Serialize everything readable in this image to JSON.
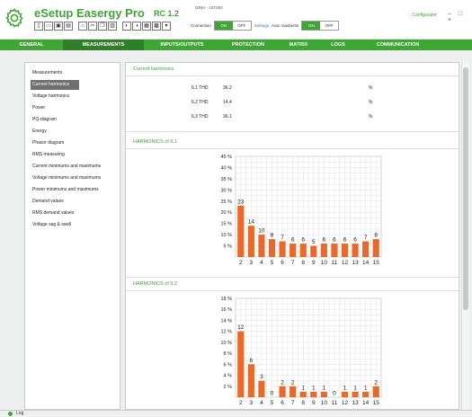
{
  "app": {
    "title": "eSetup Easergy Pro",
    "version": "RC 1.2",
    "device_id": "00NH - 16T600",
    "configurator_label": "Configurator",
    "window_controls": "– □ ×"
  },
  "toolbar": {
    "connection_label": "Connection",
    "on_label": "ON",
    "off_label": "OFF",
    "settings_label": "Settings",
    "autoread_label": "Auto read/write"
  },
  "nav": {
    "tabs": [
      {
        "label": "GENERAL"
      },
      {
        "label": "MEASUREMENTS"
      },
      {
        "label": "INPUTS/OUTPUTS"
      },
      {
        "label": "PROTECTION"
      },
      {
        "label": "MATRIX"
      },
      {
        "label": "LOGS"
      },
      {
        "label": "COMMUNICATION"
      }
    ],
    "active": "MEASUREMENTS"
  },
  "sidebar": {
    "items": [
      {
        "label": "Measurements"
      },
      {
        "label": "Current harmonics"
      },
      {
        "label": "Voltage harmonics"
      },
      {
        "label": "Power"
      },
      {
        "label": "PQ-diagram"
      },
      {
        "label": "Energy"
      },
      {
        "label": "Phasor diagram"
      },
      {
        "label": "RMS measuring"
      },
      {
        "label": "Current minimums and maximums"
      },
      {
        "label": "Voltage minimums and maximums"
      },
      {
        "label": "Power minimums and maximums"
      },
      {
        "label": "Demand values"
      },
      {
        "label": "RMS demand values"
      },
      {
        "label": "Voltage sag & swell"
      }
    ],
    "active": "Current harmonics"
  },
  "current_harmonics": {
    "title": "Current harmonics",
    "rows": [
      {
        "label": "IL1 THD",
        "value": "36.2",
        "unit": "%"
      },
      {
        "label": "IL2 THD",
        "value": "14.4",
        "unit": "%"
      },
      {
        "label": "IL3 THD",
        "value": "36.1",
        "unit": "%"
      }
    ]
  },
  "colors": {
    "brand_green": "#3fa535",
    "nav_active": "#2e7f28",
    "bar_orange": "#e8692a"
  },
  "chart_data": [
    {
      "type": "bar",
      "title": "HARMONICS of IL1",
      "categories": [
        "2",
        "3",
        "4",
        "5",
        "6",
        "7",
        "8",
        "9",
        "10",
        "11",
        "12",
        "13",
        "14",
        "15"
      ],
      "values": [
        23,
        14,
        10,
        8,
        7,
        6,
        6,
        5,
        6,
        6,
        6,
        6,
        7,
        8
      ],
      "data_labels": [
        "23",
        "14",
        "10",
        "8",
        "7",
        "6",
        "6",
        "5",
        "6",
        "6",
        "6",
        "6",
        "7",
        "8"
      ],
      "y_ticks": [
        "5 %",
        "10 %",
        "15 %",
        "20 %",
        "25 %",
        "30 %",
        "35 %",
        "40 %",
        "45 %"
      ],
      "ylim": [
        0,
        45
      ],
      "grid": true
    },
    {
      "type": "bar",
      "title": "HARMONICS of IL2",
      "categories": [
        "2",
        "3",
        "4",
        "5",
        "6",
        "7",
        "8",
        "9",
        "10",
        "11",
        "12",
        "13",
        "14",
        "15"
      ],
      "values": [
        12,
        6,
        3,
        0,
        2,
        2,
        1,
        1,
        1,
        0,
        1,
        1,
        1,
        2
      ],
      "data_labels": [
        "12",
        "6",
        "3",
        "0",
        "2",
        "2",
        "1",
        "1",
        "1",
        "0",
        "1",
        "1",
        "1",
        "2"
      ],
      "y_ticks": [
        "2 %",
        "4 %",
        "6 %",
        "8 %",
        "10 %",
        "12 %",
        "14 %",
        "16 %",
        "18 %"
      ],
      "ylim": [
        0,
        18
      ],
      "grid": true
    }
  ],
  "statusbar": {
    "log_label": "Log"
  }
}
